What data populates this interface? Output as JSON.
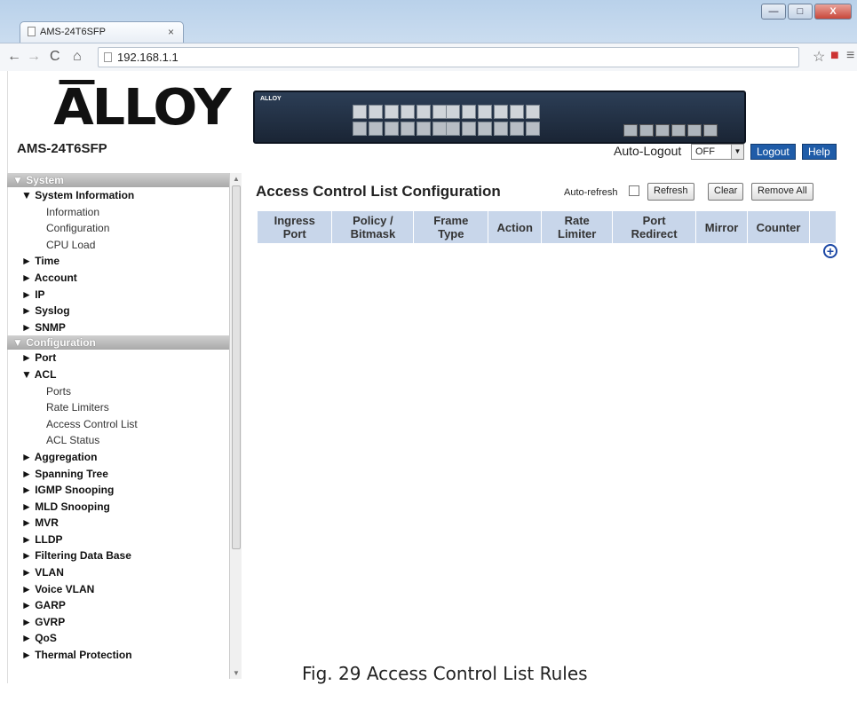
{
  "browser": {
    "tab_title": "AMS-24T6SFP",
    "tab_close": "×",
    "url": "192.168.1.1",
    "minimize": "—",
    "maximize": "□",
    "close": "X"
  },
  "header": {
    "logo_text": "ALLOY",
    "model": "AMS-24T6SFP",
    "device_brand": "ALLOY",
    "auto_logout_label": "Auto-Logout",
    "auto_logout_value": "OFF",
    "logout_label": "Logout",
    "help_label": "Help"
  },
  "sidebar": {
    "system_header": "▼ System",
    "system_info": "▼ System Information",
    "system_info_items": [
      "Information",
      "Configuration",
      "CPU Load"
    ],
    "system_sections": [
      "► Time",
      "► Account",
      "► IP",
      "► Syslog",
      "► SNMP"
    ],
    "config_header": "▼ Configuration",
    "port": "► Port",
    "acl": "▼ ACL",
    "acl_items": [
      "Ports",
      "Rate Limiters",
      "Access Control List",
      "ACL Status"
    ],
    "config_sections": [
      "► Aggregation",
      "► Spanning Tree",
      "► IGMP Snooping",
      "► MLD Snooping",
      "► MVR",
      "► LLDP",
      "► Filtering Data Base",
      "► VLAN",
      "► Voice VLAN",
      "► GARP",
      "► GVRP",
      "► QoS",
      "► Thermal Protection"
    ]
  },
  "main": {
    "title": "Access Control List Configuration",
    "auto_refresh_label": "Auto-refresh",
    "auto_refresh_checked": false,
    "refresh_label": "Refresh",
    "clear_label": "Clear",
    "remove_all_label": "Remove All",
    "columns": [
      [
        "Ingress",
        "Port"
      ],
      [
        "Policy /",
        "Bitmask"
      ],
      [
        "Frame",
        "Type"
      ],
      [
        "Action",
        ""
      ],
      [
        "Rate",
        "Limiter"
      ],
      [
        "Port",
        "Redirect"
      ],
      [
        "Mirror",
        ""
      ],
      [
        "Counter",
        ""
      ]
    ],
    "add_icon": "plus-circle-icon"
  },
  "caption": "Fig. 29 Access Control List Rules"
}
